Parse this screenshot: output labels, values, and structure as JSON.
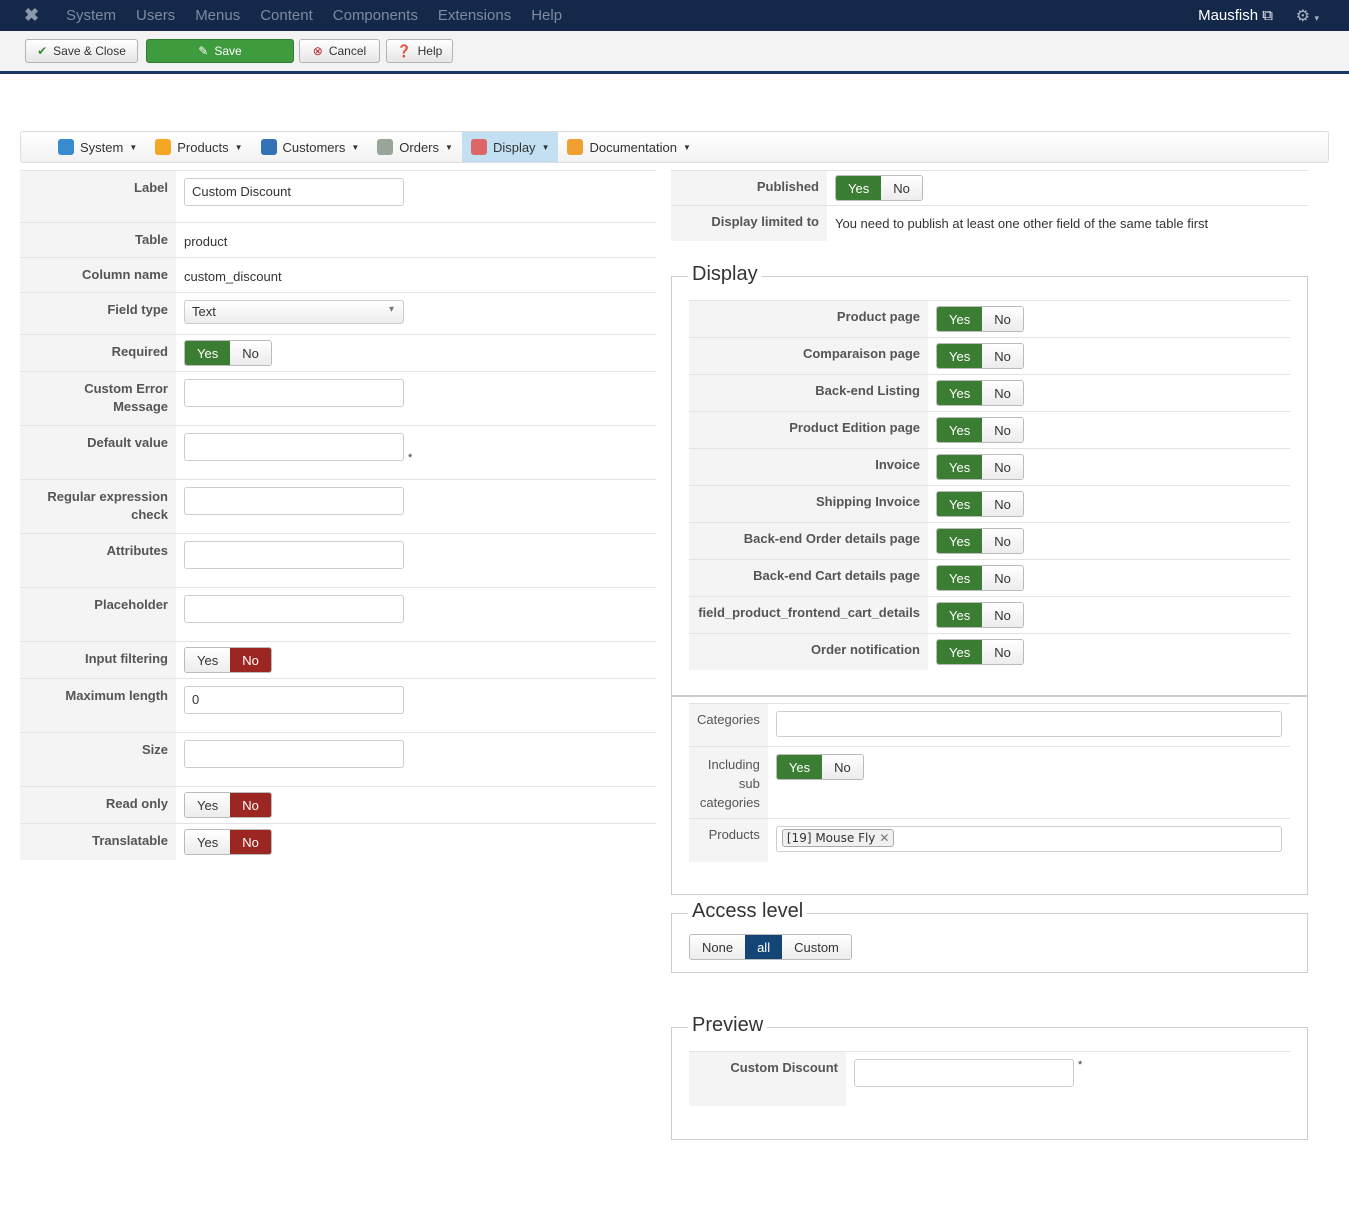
{
  "topbar": {
    "menus": [
      "System",
      "Users",
      "Menus",
      "Content",
      "Components",
      "Extensions",
      "Help"
    ],
    "user": "Mausfish"
  },
  "toolbar": {
    "save_close": "Save & Close",
    "save": "Save",
    "cancel": "Cancel",
    "help": "Help"
  },
  "subnav": [
    {
      "label": "System",
      "icon": "tools-icon",
      "color": "#3a8ad0"
    },
    {
      "label": "Products",
      "icon": "box-icon",
      "color": "#f5a623"
    },
    {
      "label": "Customers",
      "icon": "users-icon",
      "color": "#3472b8"
    },
    {
      "label": "Orders",
      "icon": "document-icon",
      "color": "#9aa59a"
    },
    {
      "label": "Display",
      "icon": "display-icon",
      "color": "#d66"
    },
    {
      "label": "Documentation",
      "icon": "lifebuoy-icon",
      "color": "#f0a030"
    }
  ],
  "left": [
    {
      "label": "Label",
      "type": "input",
      "value": "Custom Discount"
    },
    {
      "label": "Table",
      "type": "text",
      "value": "product"
    },
    {
      "label": "Column name",
      "type": "text",
      "value": "custom_discount"
    },
    {
      "label": "Field type",
      "type": "select",
      "value": "Text"
    },
    {
      "label": "Required",
      "type": "yn",
      "value": "Yes"
    },
    {
      "label": "Custom Error Message",
      "type": "input",
      "value": ""
    },
    {
      "label": "Default value",
      "type": "input",
      "value": "",
      "star": "*"
    },
    {
      "label": "Regular expression check",
      "type": "input",
      "value": ""
    },
    {
      "label": "Attributes",
      "type": "input",
      "value": ""
    },
    {
      "label": "Placeholder",
      "type": "input",
      "value": ""
    },
    {
      "label": "Input filtering",
      "type": "yn",
      "value": "No"
    },
    {
      "label": "Maximum length",
      "type": "input",
      "value": "0"
    },
    {
      "label": "Size",
      "type": "input",
      "value": ""
    },
    {
      "label": "Read only",
      "type": "yn",
      "value": "No"
    },
    {
      "label": "Translatable",
      "type": "yn",
      "value": "No"
    }
  ],
  "yes": "Yes",
  "no": "No",
  "published": {
    "label": "Published",
    "value": "Yes"
  },
  "limited": {
    "label": "Display limited to",
    "value": "You need to publish at least one other field of the same table first"
  },
  "display": {
    "legend": "Display",
    "rows": [
      "Product page",
      "Comparaison page",
      "Back-end Listing",
      "Product Edition page",
      "Invoice",
      "Shipping Invoice",
      "Back-end Order details page",
      "Back-end Cart details page",
      "field_product_frontend_cart_details",
      "Order notification"
    ]
  },
  "categories": {
    "label": "Categories",
    "value": "",
    "sub_label": "Including sub categories",
    "sub_value": "Yes",
    "products_label": "Products",
    "product_tag": "[19] Mouse Fly"
  },
  "access": {
    "legend": "Access level",
    "options": [
      "None",
      "all",
      "Custom"
    ],
    "selected": "all"
  },
  "preview": {
    "legend": "Preview",
    "label": "Custom Discount",
    "value": "",
    "star": "*"
  }
}
